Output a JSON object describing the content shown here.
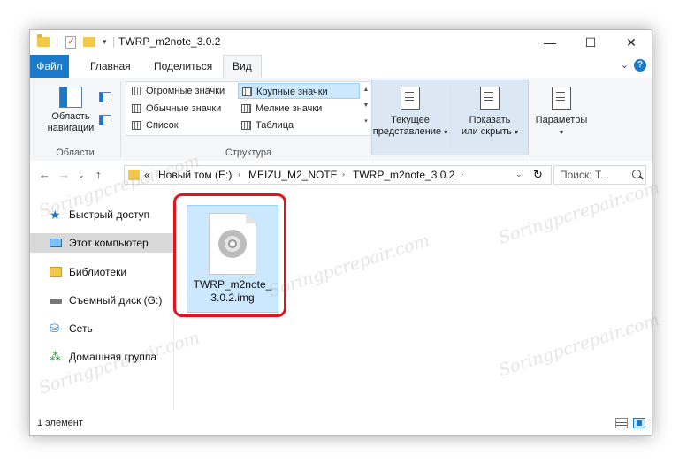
{
  "window": {
    "title": "TWRP_m2note_3.0.2",
    "controls": {
      "minimize": "—",
      "maximize": "☐",
      "close": "✕"
    }
  },
  "ribbon_tabs": [
    {
      "label": "Файл"
    },
    {
      "label": "Главная"
    },
    {
      "label": "Поделиться"
    },
    {
      "label": "Вид"
    }
  ],
  "ribbon": {
    "nav_pane_label": "Область навигации",
    "nav_pane_line1": "Область",
    "nav_pane_line2": "навигации",
    "group_panes": "Области",
    "layout_items": [
      {
        "label": "Огромные значки"
      },
      {
        "label": "Крупные значки",
        "selected": true
      },
      {
        "label": "Обычные значки"
      },
      {
        "label": "Мелкие значки"
      },
      {
        "label": "Список"
      },
      {
        "label": "Таблица"
      }
    ],
    "group_layout": "Структура",
    "current_view_line1": "Текущее",
    "current_view_line2": "представление",
    "show_hide_line1": "Показать",
    "show_hide_line2": "или скрыть",
    "options_label": "Параметры"
  },
  "address": {
    "crumbs": [
      "Новый том (E:)",
      "MEIZU_M2_NOTE",
      "TWRP_m2note_3.0.2"
    ],
    "overflow": "«",
    "search_placeholder": "Поиск: Т..."
  },
  "nav_pane": [
    {
      "label": "Быстрый доступ",
      "icon": "star-icon"
    },
    {
      "label": "Этот компьютер",
      "icon": "computer-icon",
      "selected": true
    },
    {
      "label": "Библиотеки",
      "icon": "library-icon"
    },
    {
      "label": "Съемный диск (G:)",
      "icon": "removable-disk-icon"
    },
    {
      "label": "Сеть",
      "icon": "network-icon"
    },
    {
      "label": "Домашняя группа",
      "icon": "homegroup-icon"
    }
  ],
  "files": [
    {
      "name": "TWRP_m2note_3.0.2.img",
      "icon": "disc-image-icon"
    }
  ],
  "status": {
    "count": "1 элемент"
  },
  "watermark": "Soringpcrepair.com",
  "colors": {
    "accent": "#1979ca",
    "selection": "#cce8ff",
    "highlight_outline": "#e0141e"
  }
}
